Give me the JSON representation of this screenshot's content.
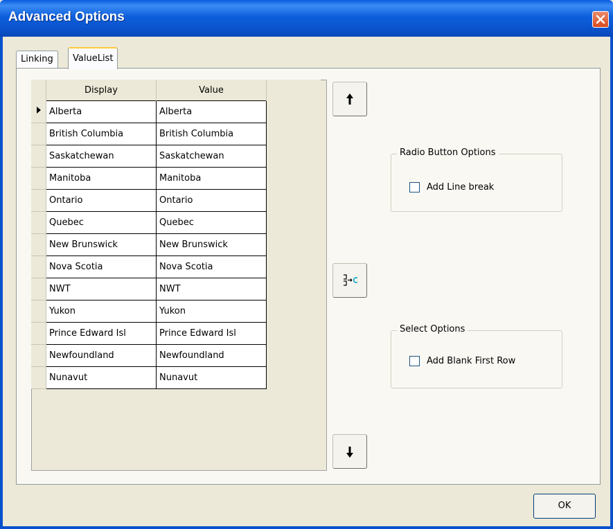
{
  "window": {
    "title": "Advanced Options"
  },
  "tabs": [
    {
      "label": "Linking",
      "active": false
    },
    {
      "label": "ValueList",
      "active": true
    }
  ],
  "grid": {
    "columns": [
      "Display",
      "Value"
    ],
    "current_row": 0,
    "rows": [
      {
        "display": "Alberta",
        "value": "Alberta"
      },
      {
        "display": "British Columbia",
        "value": "British Columbia"
      },
      {
        "display": "Saskatchewan",
        "value": "Saskatchewan"
      },
      {
        "display": "Manitoba",
        "value": "Manitoba"
      },
      {
        "display": "Ontario",
        "value": "Ontario"
      },
      {
        "display": "Quebec",
        "value": "Quebec"
      },
      {
        "display": "New Brunswick",
        "value": "New Brunswick"
      },
      {
        "display": "Nova Scotia",
        "value": "Nova Scotia"
      },
      {
        "display": "NWT",
        "value": "NWT"
      },
      {
        "display": "Yukon",
        "value": "Yukon"
      },
      {
        "display": "Prince Edward Isl",
        "value": "Prince Edward Isl"
      },
      {
        "display": "Newfoundland",
        "value": "Newfoundland"
      },
      {
        "display": "Nunavut",
        "value": "Nunavut"
      }
    ]
  },
  "buttons": {
    "move_up_icon": "arrow-up-icon",
    "copy_icon": "copy-display-to-value-icon",
    "move_down_icon": "arrow-down-icon",
    "ok_label": "OK"
  },
  "radio_button_options": {
    "legend": "Radio Button Options",
    "add_line_break_label": "Add Line break",
    "add_line_break_checked": false
  },
  "select_options": {
    "legend": "Select Options",
    "add_blank_first_row_label": "Add Blank First Row",
    "add_blank_first_row_checked": false
  }
}
